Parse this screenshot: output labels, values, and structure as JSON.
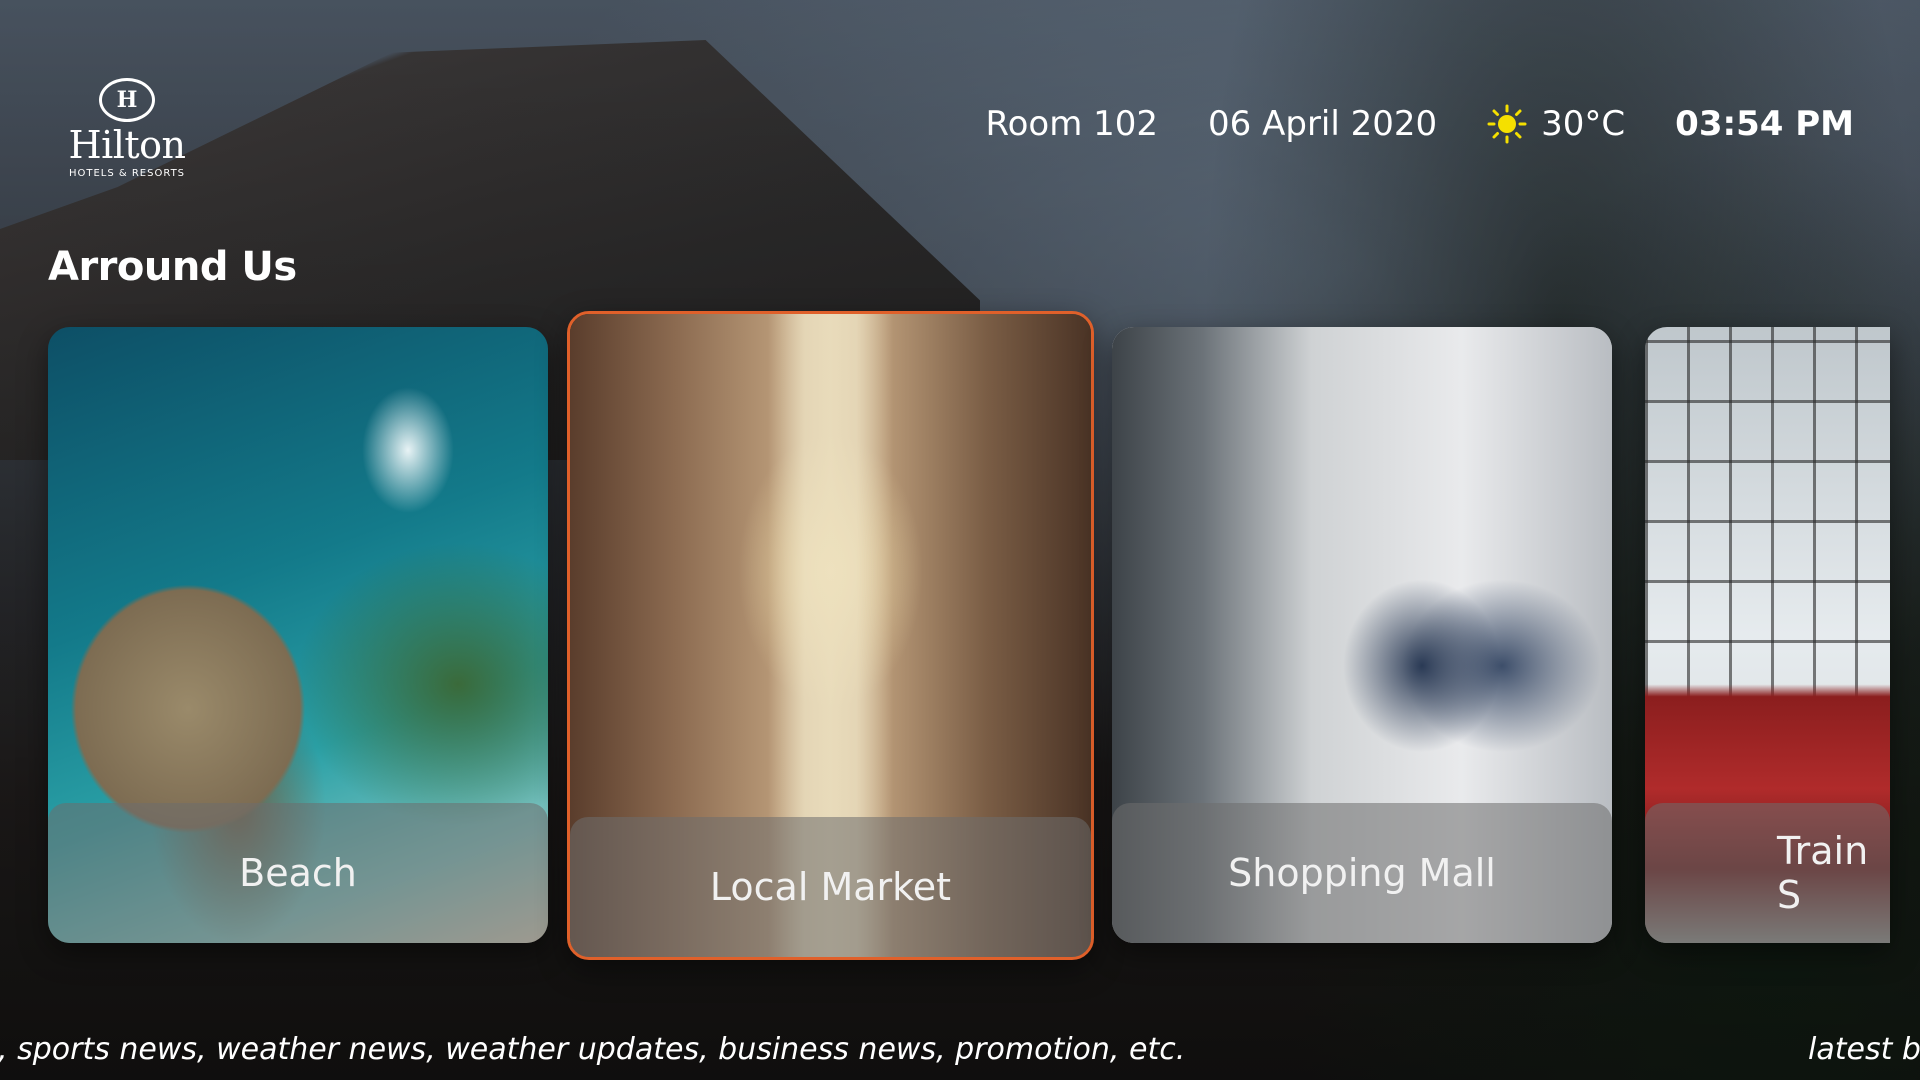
{
  "brand": {
    "logo_mark": "H",
    "name": "Hilton",
    "subtitle": "HOTELS & RESORTS"
  },
  "status": {
    "room": "Room 102",
    "date": "06 April 2020",
    "weather_icon": "sun-icon",
    "temperature": "30°C",
    "time": "03:54 PM"
  },
  "section": {
    "title": "Arround Us"
  },
  "cards": [
    {
      "label": "Beach",
      "focused": false
    },
    {
      "label": "Local Market",
      "focused": true
    },
    {
      "label": "Shopping Mall",
      "focused": false
    },
    {
      "label": "Train S",
      "focused": false
    }
  ],
  "colors": {
    "focus_border": "#e0602a",
    "sun": "#f5e000"
  },
  "ticker": {
    "left_text": ", sports news, weather news, weather updates, business news, promotion, etc.",
    "right_text": "latest b"
  }
}
